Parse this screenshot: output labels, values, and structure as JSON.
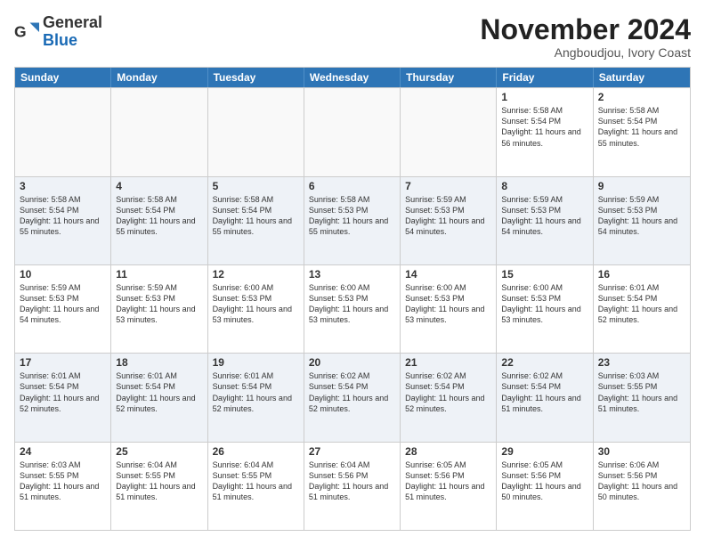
{
  "logo": {
    "general": "General",
    "blue": "Blue"
  },
  "header": {
    "month": "November 2024",
    "location": "Angboudjou, Ivory Coast"
  },
  "weekdays": [
    "Sunday",
    "Monday",
    "Tuesday",
    "Wednesday",
    "Thursday",
    "Friday",
    "Saturday"
  ],
  "weeks": [
    [
      {
        "day": "",
        "empty": true
      },
      {
        "day": "",
        "empty": true
      },
      {
        "day": "",
        "empty": true
      },
      {
        "day": "",
        "empty": true
      },
      {
        "day": "",
        "empty": true
      },
      {
        "day": "1",
        "sunrise": "5:58 AM",
        "sunset": "5:54 PM",
        "daylight": "11 hours and 56 minutes."
      },
      {
        "day": "2",
        "sunrise": "5:58 AM",
        "sunset": "5:54 PM",
        "daylight": "11 hours and 55 minutes."
      }
    ],
    [
      {
        "day": "3",
        "sunrise": "5:58 AM",
        "sunset": "5:54 PM",
        "daylight": "11 hours and 55 minutes."
      },
      {
        "day": "4",
        "sunrise": "5:58 AM",
        "sunset": "5:54 PM",
        "daylight": "11 hours and 55 minutes."
      },
      {
        "day": "5",
        "sunrise": "5:58 AM",
        "sunset": "5:54 PM",
        "daylight": "11 hours and 55 minutes."
      },
      {
        "day": "6",
        "sunrise": "5:58 AM",
        "sunset": "5:53 PM",
        "daylight": "11 hours and 55 minutes."
      },
      {
        "day": "7",
        "sunrise": "5:59 AM",
        "sunset": "5:53 PM",
        "daylight": "11 hours and 54 minutes."
      },
      {
        "day": "8",
        "sunrise": "5:59 AM",
        "sunset": "5:53 PM",
        "daylight": "11 hours and 54 minutes."
      },
      {
        "day": "9",
        "sunrise": "5:59 AM",
        "sunset": "5:53 PM",
        "daylight": "11 hours and 54 minutes."
      }
    ],
    [
      {
        "day": "10",
        "sunrise": "5:59 AM",
        "sunset": "5:53 PM",
        "daylight": "11 hours and 54 minutes."
      },
      {
        "day": "11",
        "sunrise": "5:59 AM",
        "sunset": "5:53 PM",
        "daylight": "11 hours and 53 minutes."
      },
      {
        "day": "12",
        "sunrise": "6:00 AM",
        "sunset": "5:53 PM",
        "daylight": "11 hours and 53 minutes."
      },
      {
        "day": "13",
        "sunrise": "6:00 AM",
        "sunset": "5:53 PM",
        "daylight": "11 hours and 53 minutes."
      },
      {
        "day": "14",
        "sunrise": "6:00 AM",
        "sunset": "5:53 PM",
        "daylight": "11 hours and 53 minutes."
      },
      {
        "day": "15",
        "sunrise": "6:00 AM",
        "sunset": "5:53 PM",
        "daylight": "11 hours and 53 minutes."
      },
      {
        "day": "16",
        "sunrise": "6:01 AM",
        "sunset": "5:54 PM",
        "daylight": "11 hours and 52 minutes."
      }
    ],
    [
      {
        "day": "17",
        "sunrise": "6:01 AM",
        "sunset": "5:54 PM",
        "daylight": "11 hours and 52 minutes."
      },
      {
        "day": "18",
        "sunrise": "6:01 AM",
        "sunset": "5:54 PM",
        "daylight": "11 hours and 52 minutes."
      },
      {
        "day": "19",
        "sunrise": "6:01 AM",
        "sunset": "5:54 PM",
        "daylight": "11 hours and 52 minutes."
      },
      {
        "day": "20",
        "sunrise": "6:02 AM",
        "sunset": "5:54 PM",
        "daylight": "11 hours and 52 minutes."
      },
      {
        "day": "21",
        "sunrise": "6:02 AM",
        "sunset": "5:54 PM",
        "daylight": "11 hours and 52 minutes."
      },
      {
        "day": "22",
        "sunrise": "6:02 AM",
        "sunset": "5:54 PM",
        "daylight": "11 hours and 51 minutes."
      },
      {
        "day": "23",
        "sunrise": "6:03 AM",
        "sunset": "5:55 PM",
        "daylight": "11 hours and 51 minutes."
      }
    ],
    [
      {
        "day": "24",
        "sunrise": "6:03 AM",
        "sunset": "5:55 PM",
        "daylight": "11 hours and 51 minutes."
      },
      {
        "day": "25",
        "sunrise": "6:04 AM",
        "sunset": "5:55 PM",
        "daylight": "11 hours and 51 minutes."
      },
      {
        "day": "26",
        "sunrise": "6:04 AM",
        "sunset": "5:55 PM",
        "daylight": "11 hours and 51 minutes."
      },
      {
        "day": "27",
        "sunrise": "6:04 AM",
        "sunset": "5:56 PM",
        "daylight": "11 hours and 51 minutes."
      },
      {
        "day": "28",
        "sunrise": "6:05 AM",
        "sunset": "5:56 PM",
        "daylight": "11 hours and 51 minutes."
      },
      {
        "day": "29",
        "sunrise": "6:05 AM",
        "sunset": "5:56 PM",
        "daylight": "11 hours and 50 minutes."
      },
      {
        "day": "30",
        "sunrise": "6:06 AM",
        "sunset": "5:56 PM",
        "daylight": "11 hours and 50 minutes."
      }
    ]
  ]
}
